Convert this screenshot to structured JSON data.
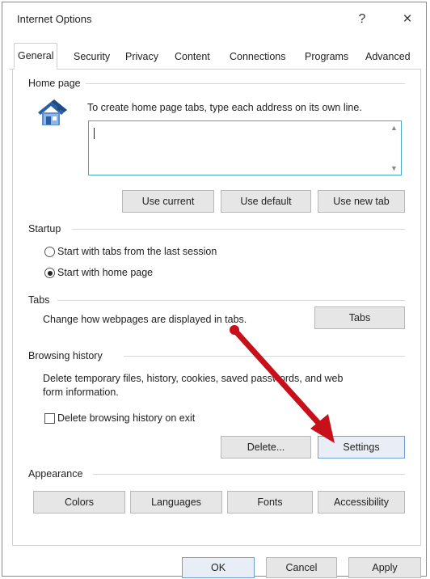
{
  "window": {
    "title": "Internet Options",
    "help": "?",
    "close": "×"
  },
  "tabs": [
    {
      "label": "General",
      "active": true
    },
    {
      "label": "Security"
    },
    {
      "label": "Privacy"
    },
    {
      "label": "Content"
    },
    {
      "label": "Connections"
    },
    {
      "label": "Programs"
    },
    {
      "label": "Advanced"
    }
  ],
  "homepage": {
    "group_label": "Home page",
    "instruction": "To create home page tabs, type each address on its own line.",
    "value": "",
    "buttons": {
      "use_current": "Use current",
      "use_default": "Use default",
      "use_new_tab": "Use new tab"
    }
  },
  "startup": {
    "group_label": "Startup",
    "option1": "Start with tabs from the last session",
    "option2": "Start with home page",
    "selected": "option2"
  },
  "tabs_group": {
    "group_label": "Tabs",
    "description": "Change how webpages are displayed in tabs.",
    "button": "Tabs"
  },
  "history": {
    "group_label": "Browsing history",
    "description_line1": "Delete temporary files, history, cookies, saved passwords, and web",
    "description_line2": "form information.",
    "checkbox_label": "Delete browsing history on exit",
    "checkbox_checked": false,
    "delete_button": "Delete...",
    "settings_button": "Settings"
  },
  "appearance": {
    "group_label": "Appearance",
    "colors": "Colors",
    "languages": "Languages",
    "fonts": "Fonts",
    "accessibility": "Accessibility"
  },
  "footer": {
    "ok": "OK",
    "cancel": "Cancel",
    "apply": "Apply"
  },
  "colors": {
    "annotation_arrow": "#c8101a",
    "focus_border": "#6f9fd8",
    "textarea_border": "#4aa3c9"
  },
  "icons": {
    "homepage": "house-icon",
    "annotation": "red-arrow-annotation"
  }
}
